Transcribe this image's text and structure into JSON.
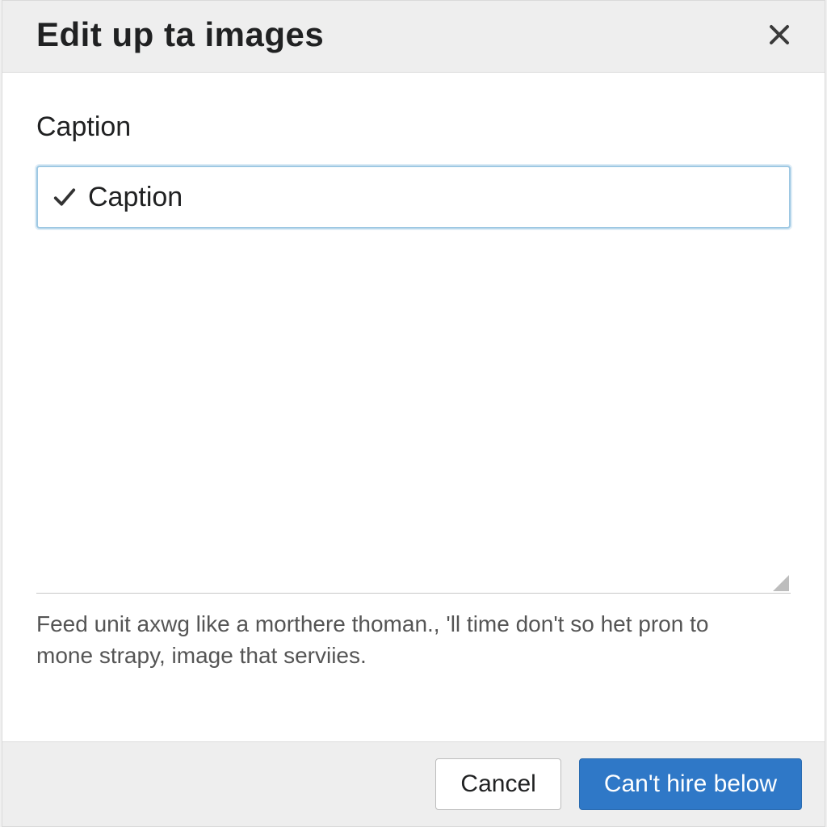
{
  "dialog": {
    "title": "Edit up ta images",
    "close_icon": "close-icon"
  },
  "form": {
    "caption_label": "Caption",
    "caption_check_icon": "check-icon",
    "caption_value": "Caption",
    "textarea_value": "",
    "helper_text": "Feed unit axwg like a morthere thoman., 'll time don't so het pron to mone strapy, image that serviies."
  },
  "footer": {
    "cancel_label": "Cancel",
    "primary_label": "Can't hire below"
  }
}
